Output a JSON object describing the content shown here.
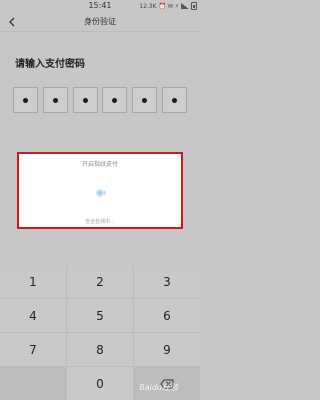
{
  "status_bar": {
    "time": "15:41",
    "right_text": "12.3K ⏰ ✉ ⚡"
  },
  "header": {
    "back_icon": "chevron-left-icon",
    "title": "身份验证"
  },
  "prompt": "请输入支付密码",
  "pin": {
    "length": 6,
    "filled": 6
  },
  "popup": {
    "title": "开启指纹支付",
    "status": "安全检测中...",
    "icon": "fingerprint-loading-icon",
    "border_color": "#d6141b"
  },
  "keypad": {
    "keys": [
      "1",
      "2",
      "3",
      "4",
      "5",
      "6",
      "7",
      "8",
      "9",
      "",
      "0",
      "⌫"
    ],
    "delete_icon": "backspace-icon"
  },
  "watermark": "Baidu经验"
}
